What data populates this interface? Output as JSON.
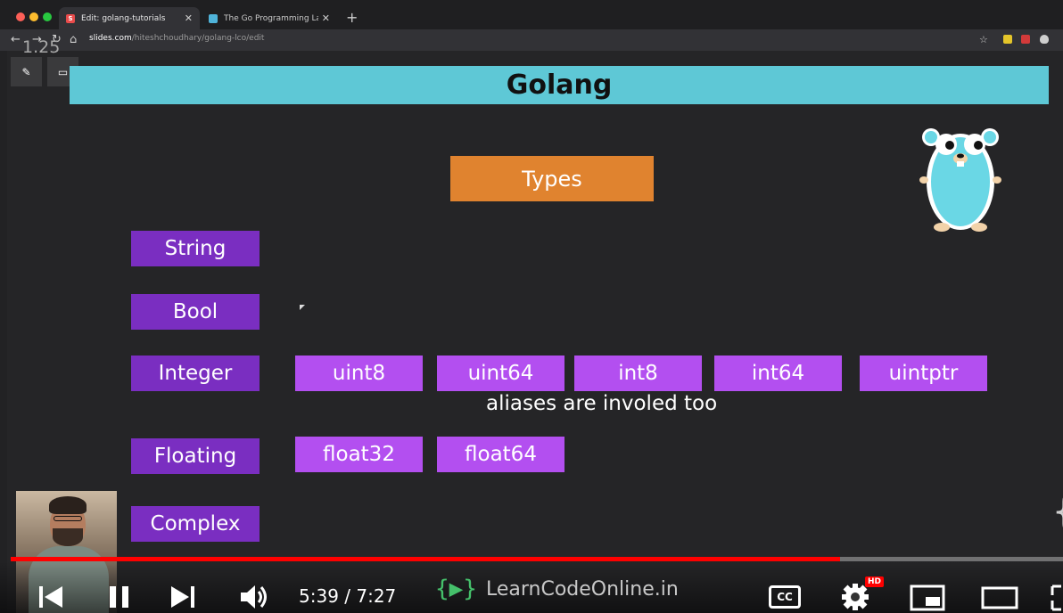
{
  "browser": {
    "tabs": [
      {
        "label": "Edit: golang-tutorials",
        "favicon": "slides-icon",
        "active": true
      },
      {
        "label": "The Go Programming Languag",
        "favicon": "go-icon",
        "active": false
      }
    ],
    "new_tab_label": "+",
    "url_host": "slides.com",
    "url_path": "/hiteshchoudhary/golang-lco/edit"
  },
  "editor": {
    "speed_label": "1.25"
  },
  "slide": {
    "title": "Golang",
    "types_label": "Types",
    "categories": [
      "String",
      "Bool",
      "Integer",
      "Floating",
      "Complex"
    ],
    "integer_types": [
      "uint8",
      "uint64",
      "int8",
      "int64",
      "uintptr"
    ],
    "aliases_note": "aliases are involed too",
    "floating_types": [
      "float32",
      "float64"
    ],
    "colors": {
      "title_bar": "#5ec8d6",
      "types_box": "#e0832f",
      "category_box": "#7a2ec1",
      "subtype_box": "#b34ff0"
    }
  },
  "player": {
    "time": "5:39 / 7:27",
    "brand": "LearnCodeOnline.in",
    "progress": 0.788,
    "hd_badge": "HD",
    "cc_label": "CC"
  }
}
